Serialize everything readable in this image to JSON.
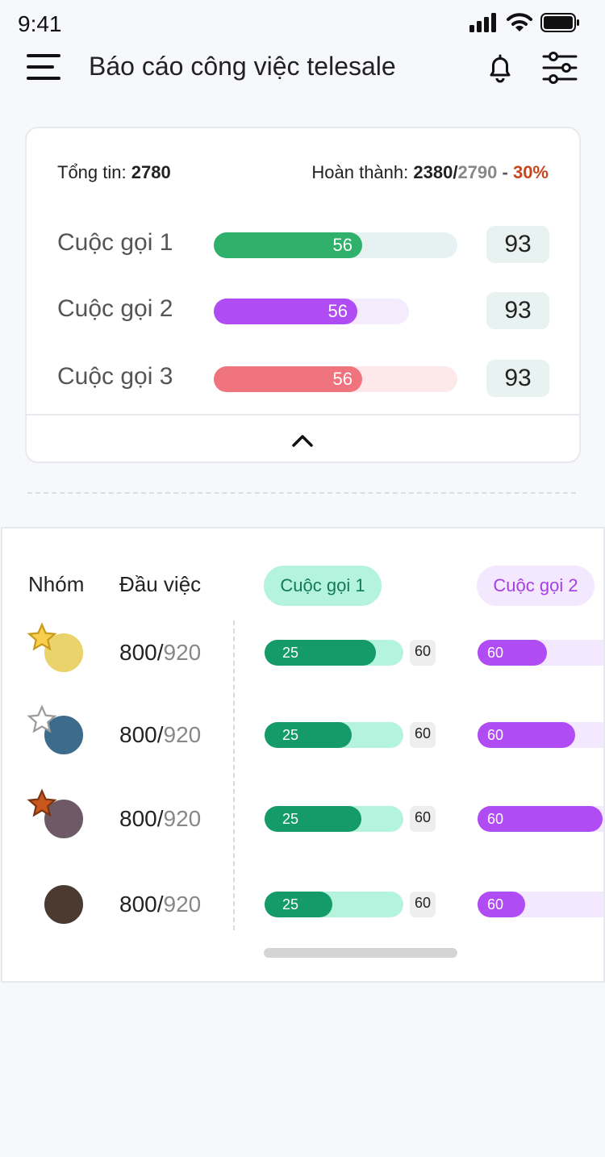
{
  "status_bar": {
    "time": "9:41"
  },
  "header": {
    "title": "Báo cáo công việc telesale"
  },
  "summary": {
    "total_label": "Tổng tin:",
    "total_value": "2780",
    "done_label": "Hoàn thành:",
    "done_value": "2380/",
    "done_target": "2790",
    "separator": " - ",
    "done_percent": "30%",
    "calls": [
      {
        "label": "Cuộc gọi 1",
        "value": "56",
        "count": "93",
        "fill_color": "#2fb06b",
        "track_color": "#e6f2f1",
        "fill_fraction": 0.61,
        "track_fraction": 1.0
      },
      {
        "label": "Cuộc gọi 2",
        "value": "56",
        "count": "93",
        "fill_color": "#b04cf3",
        "track_color": "#f4ecfd",
        "fill_fraction": 0.59,
        "track_fraction": 0.8
      },
      {
        "label": "Cuộc gọi 3",
        "value": "56",
        "count": "93",
        "fill_color": "#ef747e",
        "track_color": "#fde8ea",
        "fill_fraction": 0.61,
        "track_fraction": 1.0
      }
    ]
  },
  "table": {
    "col_group": "Nhóm",
    "col_tasks": "Đầu việc",
    "tabs": [
      {
        "label": "Cuộc gọi 1",
        "bg": "#b4f4df",
        "fg": "#127a55"
      },
      {
        "label": "Cuộc gọi 2",
        "bg": "#f4e8ff",
        "fg": "#a63fe6"
      }
    ],
    "rows": [
      {
        "done": "800/",
        "total": "920",
        "star": "gold",
        "avatar_color": "#e9d36a",
        "call1_value": "25",
        "call1_max": "60",
        "call1_fraction": 0.8,
        "call2_value": "60",
        "call2_fraction": 0.48
      },
      {
        "done": "800/",
        "total": "920",
        "star": "outline",
        "avatar_color": "#3d6b8c",
        "call1_value": "25",
        "call1_max": "60",
        "call1_fraction": 0.63,
        "call2_value": "60",
        "call2_fraction": 0.67
      },
      {
        "done": "800/",
        "total": "920",
        "star": "bronze",
        "avatar_color": "#6e5a66",
        "call1_value": "25",
        "call1_max": "60",
        "call1_fraction": 0.7,
        "call2_value": "60",
        "call2_fraction": 0.86
      },
      {
        "done": "800/",
        "total": "920",
        "star": "none",
        "avatar_color": "#4a3a30",
        "call1_value": "25",
        "call1_max": "60",
        "call1_fraction": 0.49,
        "call2_value": "60",
        "call2_fraction": 0.33
      }
    ]
  }
}
